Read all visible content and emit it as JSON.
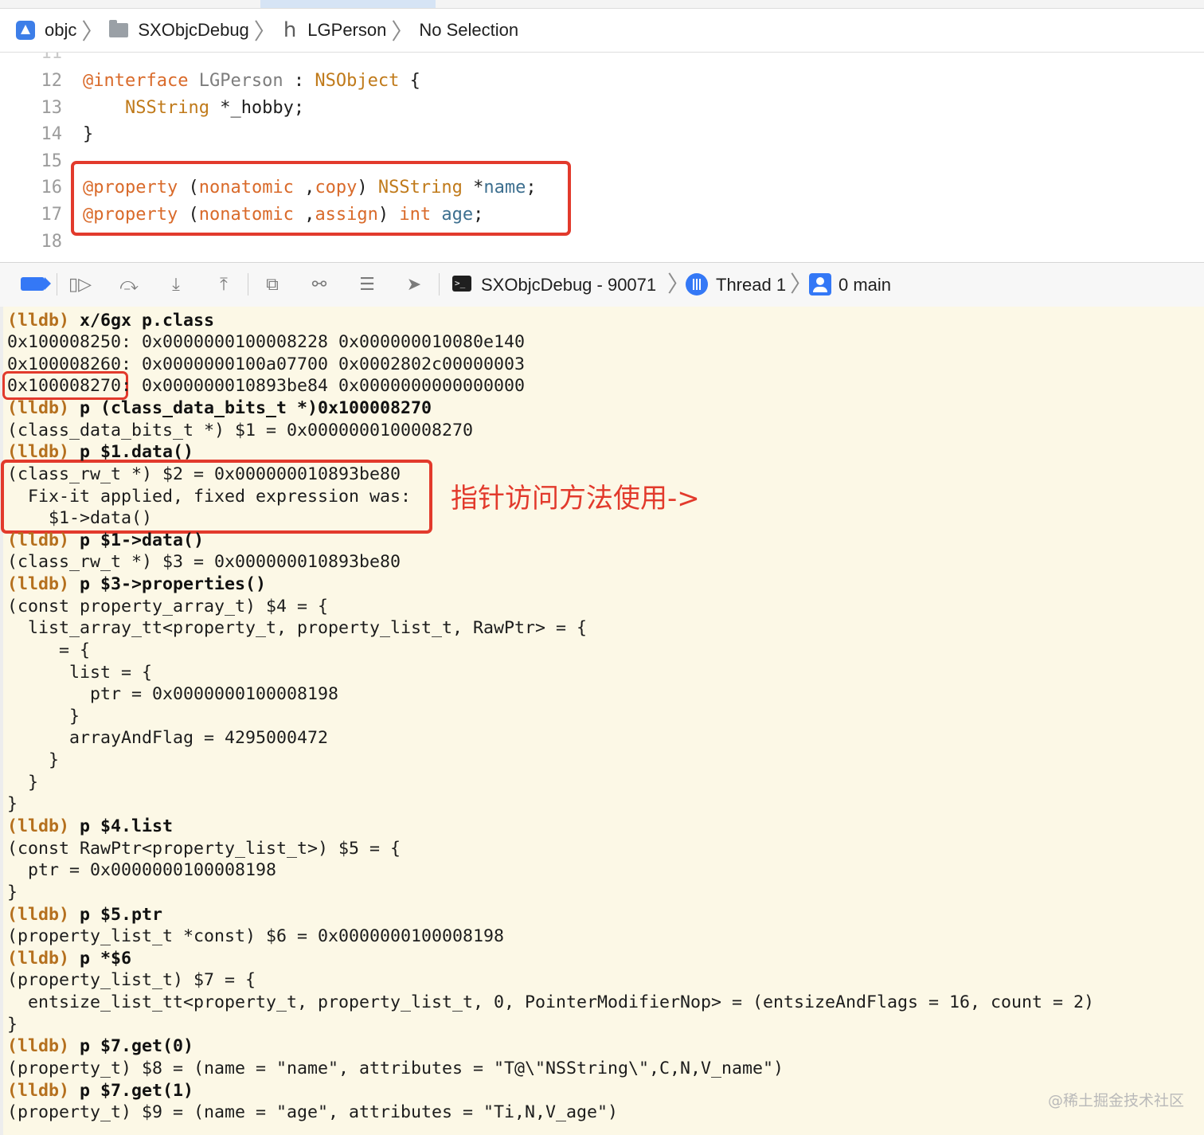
{
  "jumpbar": {
    "project": "objc",
    "folder": "SXObjcDebug",
    "file": "LGPerson",
    "selection": "No Selection"
  },
  "editor": {
    "lines": [
      {
        "num": "12",
        "parts": [
          [
            "kw",
            "@interface"
          ],
          [
            "plain",
            " "
          ],
          [
            "cls",
            "LGPerson"
          ],
          [
            "plain",
            " : "
          ],
          [
            "ty",
            "NSObject"
          ],
          [
            "plain",
            " {"
          ]
        ]
      },
      {
        "num": "13",
        "parts": [
          [
            "plain",
            "    "
          ],
          [
            "ty",
            "NSString"
          ],
          [
            "plain",
            " *_hobby;"
          ]
        ]
      },
      {
        "num": "14",
        "parts": [
          [
            "plain",
            "}"
          ]
        ]
      },
      {
        "num": "15",
        "parts": []
      },
      {
        "num": "16",
        "parts": [
          [
            "kw",
            "@property"
          ],
          [
            "plain",
            " ("
          ],
          [
            "kw",
            "nonatomic"
          ],
          [
            "plain",
            " ,"
          ],
          [
            "kw",
            "copy"
          ],
          [
            "plain",
            ") "
          ],
          [
            "ty",
            "NSString"
          ],
          [
            "plain",
            " *"
          ],
          [
            "idn",
            "name"
          ],
          [
            "plain",
            ";"
          ]
        ]
      },
      {
        "num": "17",
        "parts": [
          [
            "kw",
            "@property"
          ],
          [
            "plain",
            " ("
          ],
          [
            "kw",
            "nonatomic"
          ],
          [
            "plain",
            " ,"
          ],
          [
            "kw",
            "assign"
          ],
          [
            "plain",
            ") "
          ],
          [
            "kw",
            "int"
          ],
          [
            "plain",
            " "
          ],
          [
            "idn",
            "age"
          ],
          [
            "plain",
            ";"
          ]
        ]
      },
      {
        "num": "18",
        "parts": []
      }
    ]
  },
  "debugbar": {
    "process": "SXObjcDebug - 90071",
    "thread": "Thread 1",
    "frame": "0 main"
  },
  "console": {
    "lines": [
      {
        "prompt": "(lldb)",
        "cmd": " x/6gx p.class"
      },
      {
        "text": "0x100008250: 0x0000000100008228 0x000000010080e140"
      },
      {
        "text": "0x100008260: 0x0000000100a07700 0x0002802c00000003"
      },
      {
        "text": "0x100008270: 0x000000010893be84 0x0000000000000000"
      },
      {
        "prompt": "(lldb)",
        "cmd": " p (class_data_bits_t *)0x100008270"
      },
      {
        "text": "(class_data_bits_t *) $1 = 0x0000000100008270"
      },
      {
        "prompt": "(lldb)",
        "cmd": " p $1.data()"
      },
      {
        "text": "(class_rw_t *) $2 = 0x000000010893be80"
      },
      {
        "text": "  Fix-it applied, fixed expression was:"
      },
      {
        "text": "    $1->data()"
      },
      {
        "prompt": "(lldb)",
        "cmd": " p $1->data()"
      },
      {
        "text": "(class_rw_t *) $3 = 0x000000010893be80"
      },
      {
        "prompt": "(lldb)",
        "cmd": " p $3->properties()"
      },
      {
        "text": "(const property_array_t) $4 = {"
      },
      {
        "text": "  list_array_tt<property_t, property_list_t, RawPtr> = {"
      },
      {
        "text": "     = {"
      },
      {
        "text": "      list = {"
      },
      {
        "text": "        ptr = 0x0000000100008198"
      },
      {
        "text": "      }"
      },
      {
        "text": "      arrayAndFlag = 4295000472"
      },
      {
        "text": "    }"
      },
      {
        "text": "  }"
      },
      {
        "text": "}"
      },
      {
        "prompt": "(lldb)",
        "cmd": " p $4.list"
      },
      {
        "text": "(const RawPtr<property_list_t>) $5 = {"
      },
      {
        "text": "  ptr = 0x0000000100008198"
      },
      {
        "text": "}"
      },
      {
        "prompt": "(lldb)",
        "cmd": " p $5.ptr"
      },
      {
        "text": "(property_list_t *const) $6 = 0x0000000100008198"
      },
      {
        "prompt": "(lldb)",
        "cmd": " p *$6"
      },
      {
        "text": "(property_list_t) $7 = {"
      },
      {
        "text": "  entsize_list_tt<property_t, property_list_t, 0, PointerModifierNop> = (entsizeAndFlags = 16, count = 2)"
      },
      {
        "text": "}"
      },
      {
        "prompt": "(lldb)",
        "cmd": " p $7.get(0)"
      },
      {
        "text": "(property_t) $8 = (name = \"name\", attributes = \"T@\\\"NSString\\\",C,N,V_name\")"
      },
      {
        "prompt": "(lldb)",
        "cmd": " p $7.get(1)"
      },
      {
        "text": "(property_t) $9 = (name = \"age\", attributes = \"Ti,N,V_age\")"
      }
    ],
    "annotation": "指针访问方法使用->",
    "watermark": "@稀土掘金技术社区"
  },
  "colors": {
    "keyword": "#d96a2a",
    "type": "#c07a1a",
    "prompt": "#b5701e",
    "highlight_box": "#e23a2c",
    "console_bg": "#fcf8e6",
    "accent": "#3478f6"
  },
  "icons": [
    "app-icon",
    "folder-icon",
    "header-file-icon",
    "chevron-right-icon",
    "breakpoint-toggle-icon",
    "continue-icon",
    "step-over-icon",
    "step-into-icon",
    "step-out-icon",
    "debug-view-hierarchy-icon",
    "memory-graph-icon",
    "environment-overrides-icon",
    "simulate-location-icon",
    "terminal-icon",
    "thread-icon",
    "stack-frame-icon"
  ]
}
